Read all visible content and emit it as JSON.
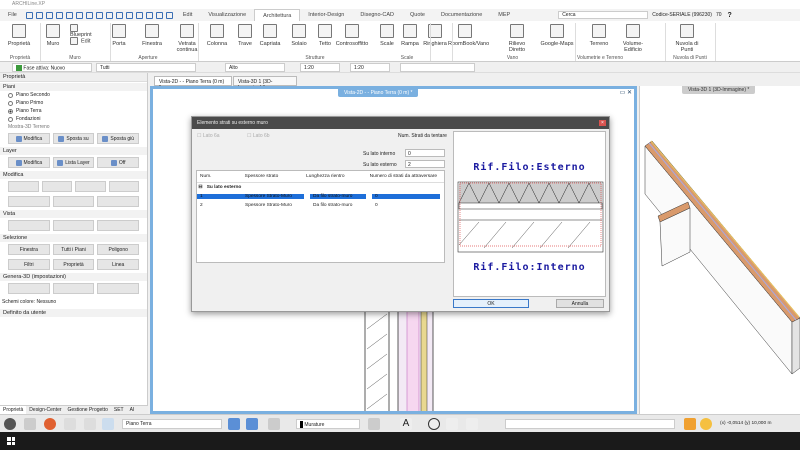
{
  "app": {
    "title": "ARCHILine.XP"
  },
  "menu": {
    "file": "File",
    "tabs": [
      "Edit",
      "Visualizzazione",
      "Architettura",
      "Interior-Design",
      "Disegno-CAD",
      "Quote",
      "Documentazione",
      "MEP"
    ],
    "active": "Architettura",
    "search_placeholder": "Cerca",
    "serial": "Codice-SERIALE (996230)",
    "counter": "70",
    "help": "?"
  },
  "ribbon": {
    "buttons": [
      "Proprietà",
      "Muro",
      "Blueprint",
      "Edit",
      "Porta",
      "Finestra",
      "Vetrata continua",
      "Colonna",
      "Trave",
      "Capriata",
      "Solaio",
      "Tetto",
      "Controsoffitto",
      "Scale",
      "Rampa",
      "Ringhiera",
      "RoomBook/Vano",
      "Rilievo Diretto",
      "Google-Maps",
      "Terreno",
      "Volume-Edificio",
      "Nuvola di Punti"
    ],
    "groups": [
      "Proprietà",
      "Muro",
      "Aperture",
      "Strutture",
      "Scale",
      "Vano",
      "Volumetrie e Terreno",
      "Nuvola di Punti"
    ]
  },
  "toolbar": {
    "phase": "Fase attiva: Nuovo",
    "filter": "Tutti",
    "height": "Alto",
    "scale1": "1:20",
    "scale2": "1:20"
  },
  "left": {
    "title": "Proprietà",
    "floors_title": "Piani",
    "floors": [
      "Piano Secondo",
      "Piano Primo",
      "Piano Terra",
      "Fondazioni"
    ],
    "selected_floor": "Piano Terra",
    "terrain": "Mostra-3D Terreno",
    "floor_buttons": [
      "Modifica",
      "Sposta su",
      "Sposta giù"
    ],
    "layer_title": "Layer",
    "layer_buttons": [
      "Modifica",
      "Lista Layer",
      "Off"
    ],
    "modify_title": "Modifica",
    "view_title": "Vista",
    "select_title": "Selezione",
    "select_buttons": [
      "Finestra",
      "Tutti i Piani",
      "Poligono",
      "Filtri",
      "Proprietà",
      "Linea"
    ],
    "gen3d_title": "Genera-3D (impostazioni)",
    "color_scheme": "Schemi colore: Nessuno",
    "user_defined": "Definito da utente",
    "tabs": [
      "Proprietà",
      "Design-Center",
      "Gestione Progetto",
      "SET",
      "AI"
    ]
  },
  "doc_tabs": [
    "Vista-2D - - Piano Terra (0 m) *",
    "Vista-3D 1 (3D-Immagine) *"
  ],
  "view2d_label": "Vista-2D - - Piano Terra (0 m) *",
  "view3d_label": "Vista-3D 1 (3D-Immagine) *",
  "dialog": {
    "title": "Elemento strati su esterno muro",
    "check_a": "Lato 6a",
    "check_b": "Lato 6b",
    "num_label": "Num. Strati da tentare",
    "inner_label": "Su lato interno",
    "inner_value": "0",
    "outer_label": "Su lato esterno",
    "outer_value": "2",
    "columns": [
      "Num.",
      "Spessore strato",
      "Lunghezza rientro",
      "Numero di strati da attraversare"
    ],
    "group": "Su lato esterno",
    "rows": [
      {
        "num": "1",
        "thickness": "Spessore Strato-Muro",
        "offset": "Da filo strato-muro",
        "count": "0"
      },
      {
        "num": "2",
        "thickness": "Spessore Strato-Muro",
        "offset": "Da filo strato-muro",
        "count": "0"
      }
    ],
    "preview_top": "Rif.Filo:Esterno",
    "preview_bottom": "Rif.Filo:Interno",
    "ok": "OK",
    "cancel": "Annulla"
  },
  "bottom": {
    "floor": "Piano Terra",
    "layer": "Murature",
    "coords": "(x) -0,0514  (y) 10,000 m"
  },
  "colors": {
    "accent": "#1e6fd9",
    "preview_text": "#1a1aa0",
    "view_border": "#7ab0e0"
  }
}
